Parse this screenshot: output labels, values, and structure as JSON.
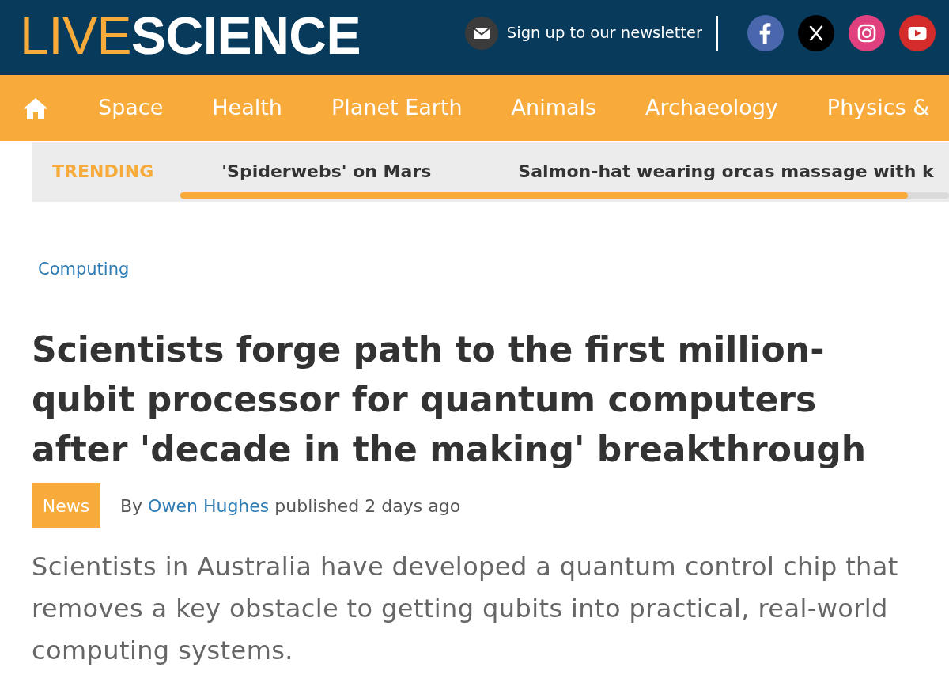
{
  "header": {
    "logo": {
      "part_1": "LIVE",
      "part_2": "SCIENCE"
    },
    "newsletter_link": "Sign up to our newsletter"
  },
  "nav": {
    "items": [
      "Space",
      "Health",
      "Planet Earth",
      "Animals",
      "Archaeology",
      "Physics &"
    ]
  },
  "trending": {
    "label": "TRENDING",
    "items": [
      "'Spiderwebs' on Mars",
      "Salmon-hat wearing orcas massage with k"
    ]
  },
  "article": {
    "category": "Computing",
    "title": "Scientists forge path to the first million-qubit processor for quantum computers after 'decade in the making' breakthrough",
    "badge": "News",
    "byline": {
      "prefix": "By",
      "author": "Owen Hughes",
      "suffix": "published 2 days ago"
    },
    "summary": "Scientists in Australia have developed a quantum control chip that removes a key obstacle to getting qubits into practical, real-world computing systems."
  }
}
